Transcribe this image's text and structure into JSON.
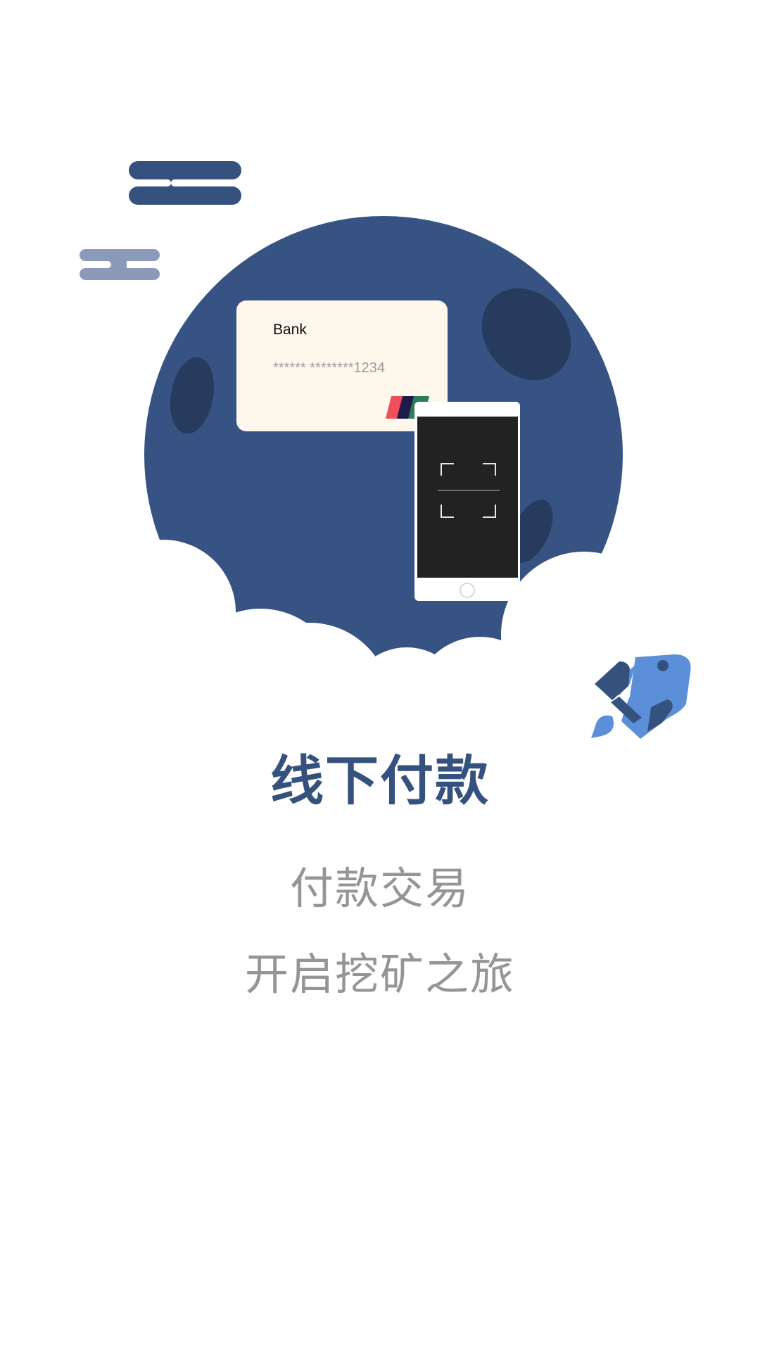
{
  "card": {
    "bank_label": "Bank",
    "number_masked": "****** ********1234"
  },
  "onboarding": {
    "title": "线下付款",
    "subtitle_line1": "付款交易",
    "subtitle_line2": "开启挖矿之旅"
  },
  "colors": {
    "brand": "#35527f",
    "planet": "#365384",
    "crater": "#263b5e",
    "rocket": "#5b8fd8",
    "card": "#fdf7ec",
    "subtitle": "#959595"
  },
  "icons": [
    "cloud-icon",
    "planet-icon",
    "bank-card-icon",
    "phone-scanner-icon",
    "rocket-icon"
  ]
}
